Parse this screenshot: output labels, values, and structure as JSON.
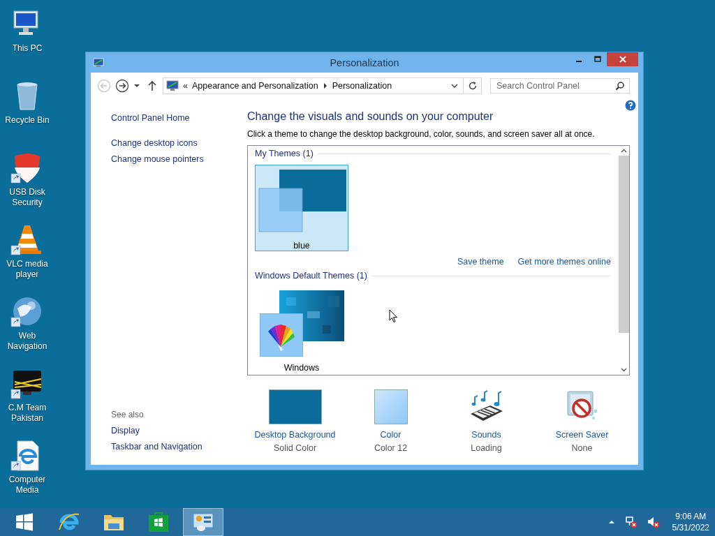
{
  "desktop_icons": [
    {
      "kind": "pc",
      "label": "This PC",
      "shortcut": false
    },
    {
      "kind": "bin",
      "label": "Recycle Bin",
      "shortcut": false
    },
    {
      "kind": "shield",
      "label": "USB Disk Security",
      "shortcut": true
    },
    {
      "kind": "cone",
      "label": "VLC media player",
      "shortcut": true
    },
    {
      "kind": "globe",
      "label": "Web Navigation",
      "shortcut": true
    },
    {
      "kind": "monitor",
      "label": "C.M Team Pakistan",
      "shortcut": true
    },
    {
      "kind": "ie-doc",
      "label": "Computer Media",
      "shortcut": true
    }
  ],
  "window": {
    "title": "Personalization",
    "nav_buttons": [
      {
        "kind": "back",
        "disabled": true
      },
      {
        "kind": "forward",
        "disabled": false
      },
      {
        "kind": "recent",
        "disabled": false
      },
      {
        "kind": "up",
        "disabled": false
      }
    ],
    "address": {
      "overflow_mark": "«",
      "crumbs": [
        "Appearance and Personalization",
        "Personalization"
      ]
    },
    "search": {
      "placeholder": "Search Control Panel"
    },
    "sidebar": {
      "links": [
        "Control Panel Home",
        "Change desktop icons",
        "Change mouse pointers"
      ],
      "see_also_title": "See also",
      "see_also": [
        "Display",
        "Taskbar and Navigation"
      ]
    },
    "heading": "Change the visuals and sounds on your computer",
    "subheading": "Click a theme to change the desktop background, color, sounds, and screen saver all at once.",
    "theme_groups": [
      {
        "title": "My Themes (1)",
        "themes": [
          {
            "kind": "solid",
            "name": "blue",
            "selected": true
          }
        ],
        "links": [
          "Save theme",
          "Get more themes online"
        ]
      },
      {
        "title": "Windows Default Themes (1)",
        "themes": [
          {
            "kind": "wallpaper",
            "name": "Windows",
            "selected": false
          }
        ]
      }
    ],
    "settings": [
      {
        "kind": "background",
        "label": "Desktop Background",
        "value": "Solid Color"
      },
      {
        "kind": "color",
        "label": "Color",
        "value": "Color 12"
      },
      {
        "kind": "sounds",
        "label": "Sounds",
        "value": "Loading"
      },
      {
        "kind": "screensaver",
        "label": "Screen Saver",
        "value": "None"
      }
    ]
  },
  "taskbar": {
    "items": [
      {
        "kind": "start",
        "selected": false
      },
      {
        "kind": "ie",
        "selected": false
      },
      {
        "kind": "explorer",
        "selected": false
      },
      {
        "kind": "store",
        "selected": false
      },
      {
        "kind": "control-panel",
        "selected": true
      }
    ],
    "tray": [
      {
        "kind": "arrow"
      },
      {
        "kind": "network"
      },
      {
        "kind": "volume"
      }
    ],
    "time": "9:06 AM",
    "date": "5/31/2022"
  }
}
